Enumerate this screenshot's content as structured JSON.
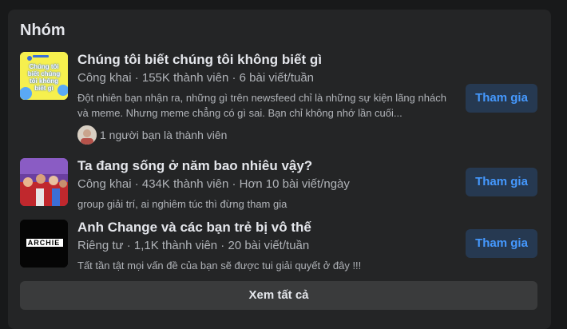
{
  "section": {
    "title": "Nhóm",
    "see_all_label": "Xem tất cả"
  },
  "groups": [
    {
      "name": "Chúng tôi biết chúng tôi không biết gì",
      "meta": "Công khai · 155K thành viên · 6 bài viết/tuần",
      "description": "Đột nhiên bạn nhận ra, những gì trên newsfeed chỉ là những sự kiện lãng nhách và meme. Nhưng meme chẳng có gì sai. Bạn chỉ không nhớ lần cuối...",
      "friends_text": "1 người bạn là thành viên",
      "thumb_text": "Chúng tôi biết chúng tôi không biết gì",
      "join_label": "Tham gia"
    },
    {
      "name": "Ta đang sống ở năm bao nhiêu vậy?",
      "meta": "Công khai · 434K thành viên · Hơn 10 bài viết/ngày",
      "description": "group giải trí, ai nghiêm túc thì đừng tham gia",
      "join_label": "Tham gia"
    },
    {
      "name": "Anh Change và các bạn trẻ bị vô thế",
      "meta": "Riêng tư · 1,1K thành viên · 20 bài viết/tuần",
      "description": "Tất tần tật mọi vấn đề của bạn sẽ được tui giải quyết ở đây !!!",
      "thumb_text": "ARCHIE",
      "join_label": "Tham gia"
    }
  ],
  "colors": {
    "card_bg": "#242526",
    "join_bg": "#263951",
    "join_text": "#4599ff",
    "button_bg": "#3a3b3c",
    "secondary_text": "#b0b3b8"
  }
}
